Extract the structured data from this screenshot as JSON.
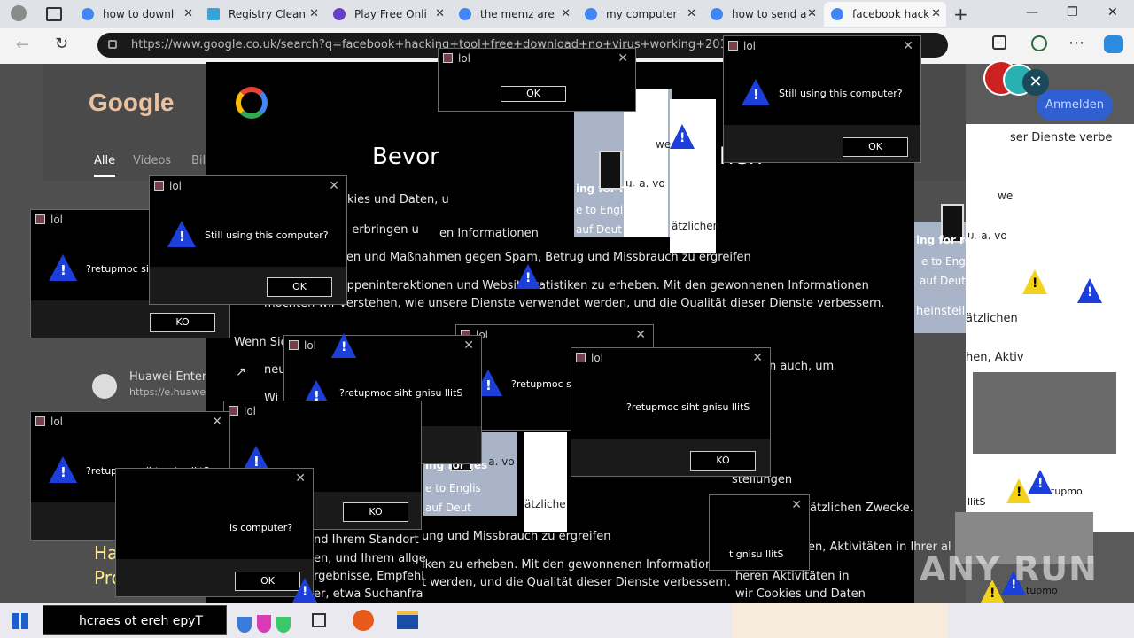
{
  "browser": {
    "tabs": [
      {
        "title": "how to downl"
      },
      {
        "title": "Registry Clean"
      },
      {
        "title": "Play Free Onli"
      },
      {
        "title": "the memz are"
      },
      {
        "title": "my computer"
      },
      {
        "title": "how to send a"
      },
      {
        "title": "facebook hack"
      }
    ],
    "url": "https://www.google.co.uk/search?q=facebook+hacking+tool+free+download+no+virus+working+2016",
    "new_tab": "+",
    "minimize": "—",
    "restore": "❐",
    "close": "✕"
  },
  "google_page": {
    "logo": "Google",
    "nav_tabs": [
      "Alle",
      "Videos",
      "Bil"
    ],
    "anmelden": "Anmelden",
    "huawei_title": "Huawei Enterp",
    "huawei_url": "https://e.huawei",
    "side_text": [
      "Ha",
      "Pro"
    ]
  },
  "consent": {
    "heading": "Bevor",
    "heading_tail": "hen",
    "lines": [
      "kies und Daten, u",
      "zu erbringen u",
      "en Informationen",
      "ufen und Maßnahmen gegen Spam, Betrug und Missbrauch zu ergreifen",
      "ruppeninteraktionen und Websitestatistiken zu erheben. Mit den gewonnenen Informationen",
      "möchten wir verstehen, wie unsere Dienste verwendet werden, und die Qualität dieser Dienste verbessern.",
      "Wenn Sie",
      "neu",
      "Wi",
      "n auch, um",
      "stellungen",
      "ätzlichen Zwecke.",
      "nd Ihrem Standort",
      "en, und Ihrem allge",
      "rgebnisse, Empfehl",
      "er, etwa Suchanfra",
      "en, Aktivitäten in Ihrer al",
      "heren Aktivitäten in",
      "wir Cookies und Daten",
      "ung und Missbrauch zu ergreifen",
      "iken zu erheben. Mit den gewonnenen Informationen",
      "t werden, und die Qualität dieser Dienste verbessern.",
      "heinstellu",
      "ätzlichen ",
      "hen, Aktiv",
      "ser Dienste verbe"
    ]
  },
  "fragments": {
    "ua": "u. a. vo",
    "we": "we",
    "zus": "ätzliche",
    "zus2": "ätzlichen",
    "ing_for": "ing for res",
    "e_to": "e to Englis",
    "auf": "auf Deut",
    "ak": "ak"
  },
  "dialogs": {
    "title": "lol",
    "still": "Still using this computer?",
    "reversed": "?retupmoc siht gnisu llitS",
    "reversed_partial": "?retupmoc siht gnisu l",
    "reversed_tail": "retupmoc siht gnisu llitS",
    "computer_tail": "is computer?",
    "gnisu_tail": "t gnisu llitS",
    "ok": "OK",
    "ko": "KO",
    "tupmo": "tupmo",
    "llits": "llitS"
  },
  "taskbar": {
    "search_text": "hcraes ot ereh epyT"
  },
  "watermark": "ANY RUN",
  "colors": {
    "warning_blue": "#1d3fd9",
    "warning_yellow": "#f2d21b",
    "dialog_bg": "#000000",
    "tabbar": "#dfe3e8"
  }
}
